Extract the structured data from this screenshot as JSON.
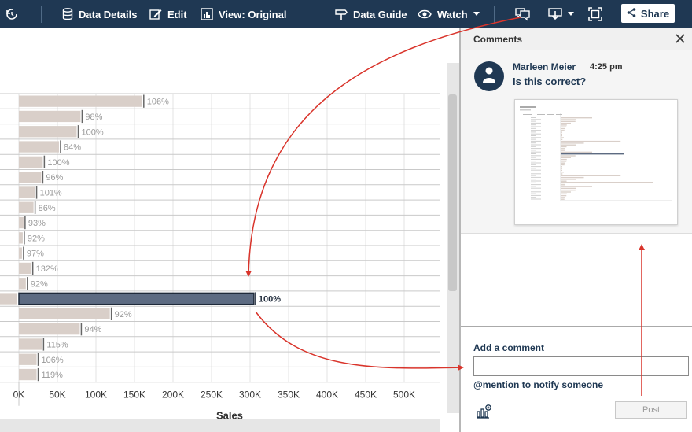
{
  "toolbar": {
    "items": [
      {
        "label": "",
        "icon": "revert-icon"
      },
      {
        "label": "Data Details",
        "icon": "database-icon"
      },
      {
        "label": "Edit",
        "icon": "edit-icon"
      },
      {
        "label": "View: Original",
        "icon": "view-icon"
      },
      {
        "label": "Data Guide",
        "icon": "signpost-icon"
      },
      {
        "label": "Watch",
        "icon": "eye-icon"
      }
    ],
    "share_label": "Share",
    "colors": {
      "bar": "#1f3853"
    }
  },
  "chart_data": {
    "type": "bar",
    "orientation": "horizontal",
    "xlabel": "Sales",
    "xlim": [
      0,
      550000
    ],
    "x_ticks": [
      "0K",
      "50K",
      "100K",
      "150K",
      "200K",
      "250K",
      "300K",
      "350K",
      "400K",
      "450K",
      "500K"
    ],
    "grid": true,
    "series": [
      {
        "values": [
          160000,
          80000,
          75000,
          52000,
          31000,
          29000,
          21000,
          19000,
          6000,
          5000,
          4000,
          16000,
          9000,
          305000,
          118000,
          79000,
          30000,
          23000,
          23000
        ]
      }
    ],
    "data_labels": [
      "106%",
      "98%",
      "100%",
      "84%",
      "100%",
      "96%",
      "101%",
      "86%",
      "93%",
      "92%",
      "97%",
      "132%",
      "92%",
      "100%",
      "92%",
      "94%",
      "115%",
      "106%",
      "119%"
    ],
    "highlighted_index": 13,
    "colors": {
      "default": "#d9cfc9",
      "highlight": "#5d6b82",
      "reference": "#666666"
    }
  },
  "comments": {
    "title": "Comments",
    "items": [
      {
        "author": "Marleen Meier",
        "time": "4:25 pm",
        "text": "Is this correct?"
      }
    ],
    "add_label": "Add a comment",
    "input_value": "",
    "mention_hint": "@mention to notify someone",
    "post_label": "Post"
  },
  "annotation_color": "#d9342b"
}
